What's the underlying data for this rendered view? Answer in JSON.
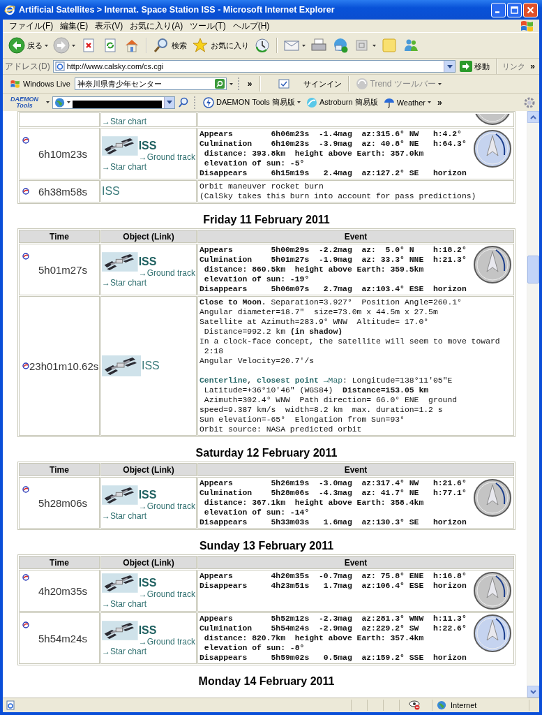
{
  "window": {
    "title": "Artificial Satellites > Internat. Space Station ISS - Microsoft Internet Explorer"
  },
  "menu": [
    "ファイル(F)",
    "編集(E)",
    "表示(V)",
    "お気に入り(A)",
    "ツール(T)",
    "ヘルプ(H)"
  ],
  "toolbar": {
    "back": "戻る",
    "search": "検索",
    "favorites": "お気に入り"
  },
  "address_bar": {
    "label": "アドレス(D)",
    "url": "http://www.calsky.com/cs.cgi",
    "go": "移動",
    "links": "リンク",
    "overflow": "»"
  },
  "live_toolbar": {
    "brand": "Windows Live",
    "search_value": "神奈川県青少年センター",
    "overflow": "»",
    "sign_in": "サインイン",
    "trend": {
      "label": "Trend ツールバー",
      "disabled": true
    }
  },
  "daemon_toolbar": {
    "logo": [
      "DAEMON",
      "Tools"
    ],
    "items": [
      {
        "label": "DAEMON Tools 簡易版",
        "menu": true
      },
      {
        "label": "Astroburn 簡易版",
        "menu": false
      },
      {
        "label": "Weather",
        "menu": true
      }
    ],
    "overflow": "»"
  },
  "days": [
    {
      "rows": [
        {
          "kind": "cut",
          "star_chart": "→Star chart",
          "tinted": false
        },
        {
          "kind": "pass",
          "time": "6h10m23s",
          "object": "ISS",
          "ground_track": "→Ground track",
          "star_chart": "→Star chart",
          "tinted": true,
          "lines": [
            "Appears        6h06m23s  -1.4mag  az:315.6° NW   h:4.2°",
            "Culmination    6h10m23s  -3.9mag  az: 40.8° NE   h:64.3°",
            " distance: 393.8km  height above Earth: 357.0km",
            " elevation of sun: -5°",
            "Disappears     6h15m19s   2.4mag  az:127.2° SE   horizon"
          ]
        },
        {
          "kind": "note",
          "time": "6h38m58s",
          "object": "ISS",
          "lines": [
            "Orbit maneuver rocket burn",
            "(CalSky takes this burn into account for pass predictions)"
          ]
        }
      ]
    },
    {
      "heading": "Friday 11 February 2011",
      "columns": [
        "Time",
        "Object (Link)",
        "Event"
      ],
      "rows": [
        {
          "kind": "pass",
          "time": "5h01m27s",
          "object": "ISS",
          "ground_track": "→Ground track",
          "star_chart": "→Star chart",
          "tinted": false,
          "lines": [
            "Appears        5h00m29s  -2.2mag  az:  5.0° N    h:18.2°",
            "Culmination    5h01m27s  -1.9mag  az: 33.3° NNE  h:21.3°",
            " distance: 860.5km  height above Earth: 359.5km",
            " elevation of sun: -19°",
            "Disappears     5h06m07s   2.7mag  az:103.4° ESE  horizon"
          ]
        },
        {
          "kind": "conjunction",
          "time": "23h01m10.62s",
          "object": "ISS",
          "paragraphs": [
            [
              "**Close to Moon.** Separation=3.927°  Position Angle=260.1°",
              "Angular diameter=18.7″  size=73.0m x 44.5m x 27.5m",
              "Satellite at Azimuth=283.9° WNW  Altitude= 17.0°",
              " Distance=992.2 km **(in shadow)**",
              "In a clock-face concept, the satellite will seem to move toward",
              " 2:18",
              "Angular Velocity=20.7'/s"
            ],
            [
              [
                {
                  "link": "Centerline",
                  "bold": true
                },
                ", ",
                {
                  "link": "closest point",
                  "bold": true
                },
                {
                  "link": " →Map",
                  "bold": false
                },
                ": Longitude=138°11'05″E"
              ],
              " Latitude=+36°10'46″ (WGS84)  **Distance=153.05 km**",
              " Azimuth=302.4° WNW  Path direction= 66.0° ENE  ground",
              "speed=9.387 km/s  width=8.2 km  max. duration=1.2 s",
              "Sun elevation=-65°  Elongation from Sun=93°",
              "Orbit source: NASA predicted orbit"
            ]
          ]
        }
      ]
    },
    {
      "heading": "Saturday 12 February 2011",
      "columns": [
        "Time",
        "Object (Link)",
        "Event"
      ],
      "rows": [
        {
          "kind": "pass",
          "time": "5h28m06s",
          "object": "ISS",
          "ground_track": "→Ground track",
          "star_chart": "→Star chart",
          "tinted": false,
          "lines": [
            "Appears        5h26m19s  -3.0mag  az:317.4° NW   h:21.6°",
            "Culmination    5h28m06s  -4.3mag  az: 41.7° NE   h:77.1°",
            " distance: 367.1km  height above Earth: 358.4km",
            " elevation of sun: -14°",
            "Disappears     5h33m03s   1.6mag  az:130.3° SE   horizon"
          ]
        }
      ]
    },
    {
      "heading": "Sunday 13 February 2011",
      "columns": [
        "Time",
        "Object (Link)",
        "Event"
      ],
      "rows": [
        {
          "kind": "pass",
          "time": "4h20m35s",
          "object": "ISS",
          "ground_track": "→Ground track",
          "star_chart": "→Star chart",
          "tinted": false,
          "lines": [
            "Appears        4h20m35s  -0.7mag  az: 75.8° ENE  h:16.8°",
            "Disappears     4h23m51s   1.7mag  az:106.4° ESE  horizon"
          ]
        },
        {
          "kind": "pass",
          "time": "5h54m24s",
          "object": "ISS",
          "ground_track": "→Ground track",
          "star_chart": "→Star chart",
          "tinted": true,
          "lines": [
            "Appears        5h52m12s  -2.3mag  az:281.3° WNW  h:11.3°",
            "Culmination    5h54m24s  -2.9mag  az:229.2° SW   h:22.6°",
            " distance: 820.7km  height above Earth: 357.4km",
            " elevation of sun: -8°",
            "Disappears     5h59m02s   0.5mag  az:159.2° SSE  horizon"
          ]
        }
      ]
    },
    {
      "heading": "Monday 14 February 2011"
    }
  ],
  "status_bar": {
    "zone": "Internet"
  }
}
